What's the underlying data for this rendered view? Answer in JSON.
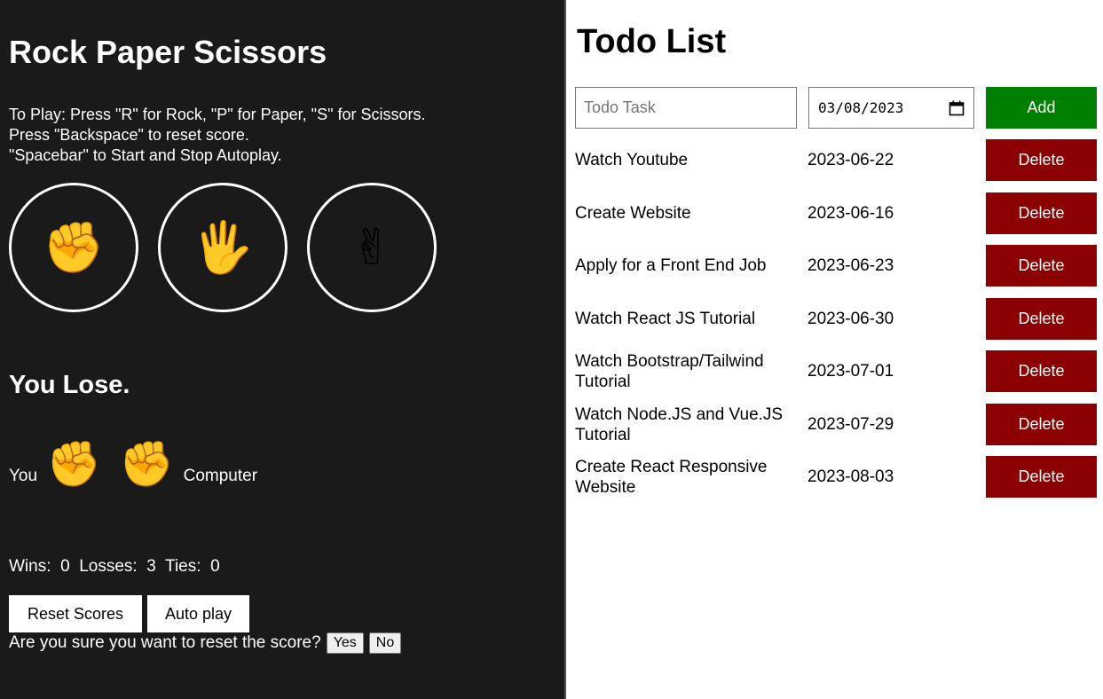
{
  "rps": {
    "title": "Rock Paper Scissors",
    "instructions": [
      "To Play: Press \"R\" for Rock, \"P\" for Paper, \"S\" for Scissors.",
      "Press \"Backspace\" to reset score.",
      "\"Spacebar\" to Start and Stop Autoplay."
    ],
    "moves": {
      "rock": "✊",
      "paper": "🖐",
      "scissors": "✌"
    },
    "result": "You Lose.",
    "you_label": "You",
    "computer_label": "Computer",
    "player_move": "✊",
    "computer_move": "✊",
    "score": {
      "wins_label": "Wins:",
      "wins": "0",
      "losses_label": "Losses:",
      "losses": "3",
      "ties_label": "Ties:",
      "ties": "0"
    },
    "reset_label": "Reset Scores",
    "autoplay_label": "Auto play",
    "confirm_text": "Are you sure you want to reset the score?",
    "yes_label": "Yes",
    "no_label": "No",
    "colors": {
      "background": "#1a1a1a",
      "text": "#ffffff"
    }
  },
  "todo": {
    "title": "Todo List",
    "input_placeholder": "Todo Task",
    "date_value": "03/08/2023",
    "add_label": "Add",
    "delete_label": "Delete",
    "items": [
      {
        "name": "Watch Youtube",
        "date": "2023-06-22"
      },
      {
        "name": "Create Website",
        "date": "2023-06-16"
      },
      {
        "name": "Apply for a Front End Job",
        "date": "2023-06-23"
      },
      {
        "name": "Watch React JS Tutorial",
        "date": "2023-06-30"
      },
      {
        "name": "Watch Bootstrap/Tailwind Tutorial",
        "date": "2023-07-01"
      },
      {
        "name": "Watch Node.JS and Vue.JS Tutorial",
        "date": "2023-07-29"
      },
      {
        "name": "Create React Responsive Website",
        "date": "2023-08-03"
      }
    ],
    "colors": {
      "add": "#008000",
      "delete": "#8b0000"
    }
  }
}
